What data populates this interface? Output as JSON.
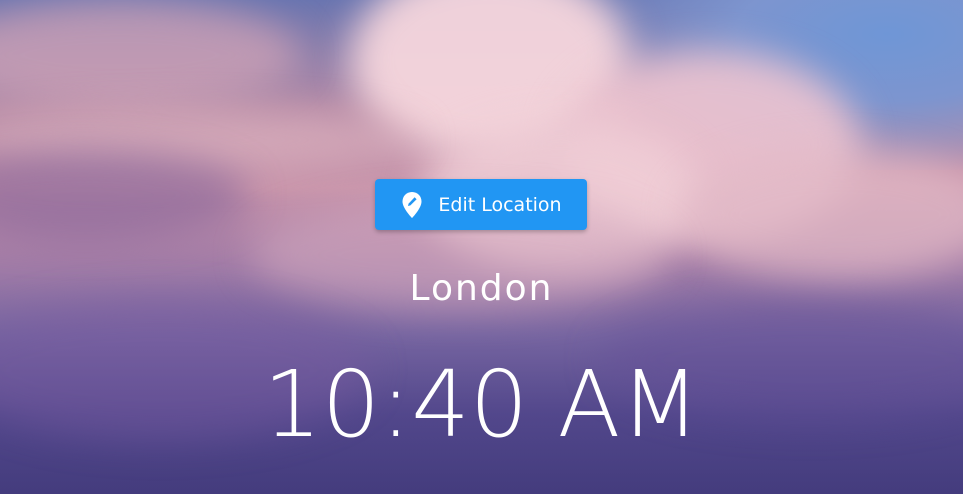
{
  "edit_location": {
    "label": "Edit Location",
    "icon": "location-edit-icon",
    "background_color": "#2196f3"
  },
  "location": {
    "name": "London"
  },
  "clock": {
    "time": "10:40 AM"
  }
}
